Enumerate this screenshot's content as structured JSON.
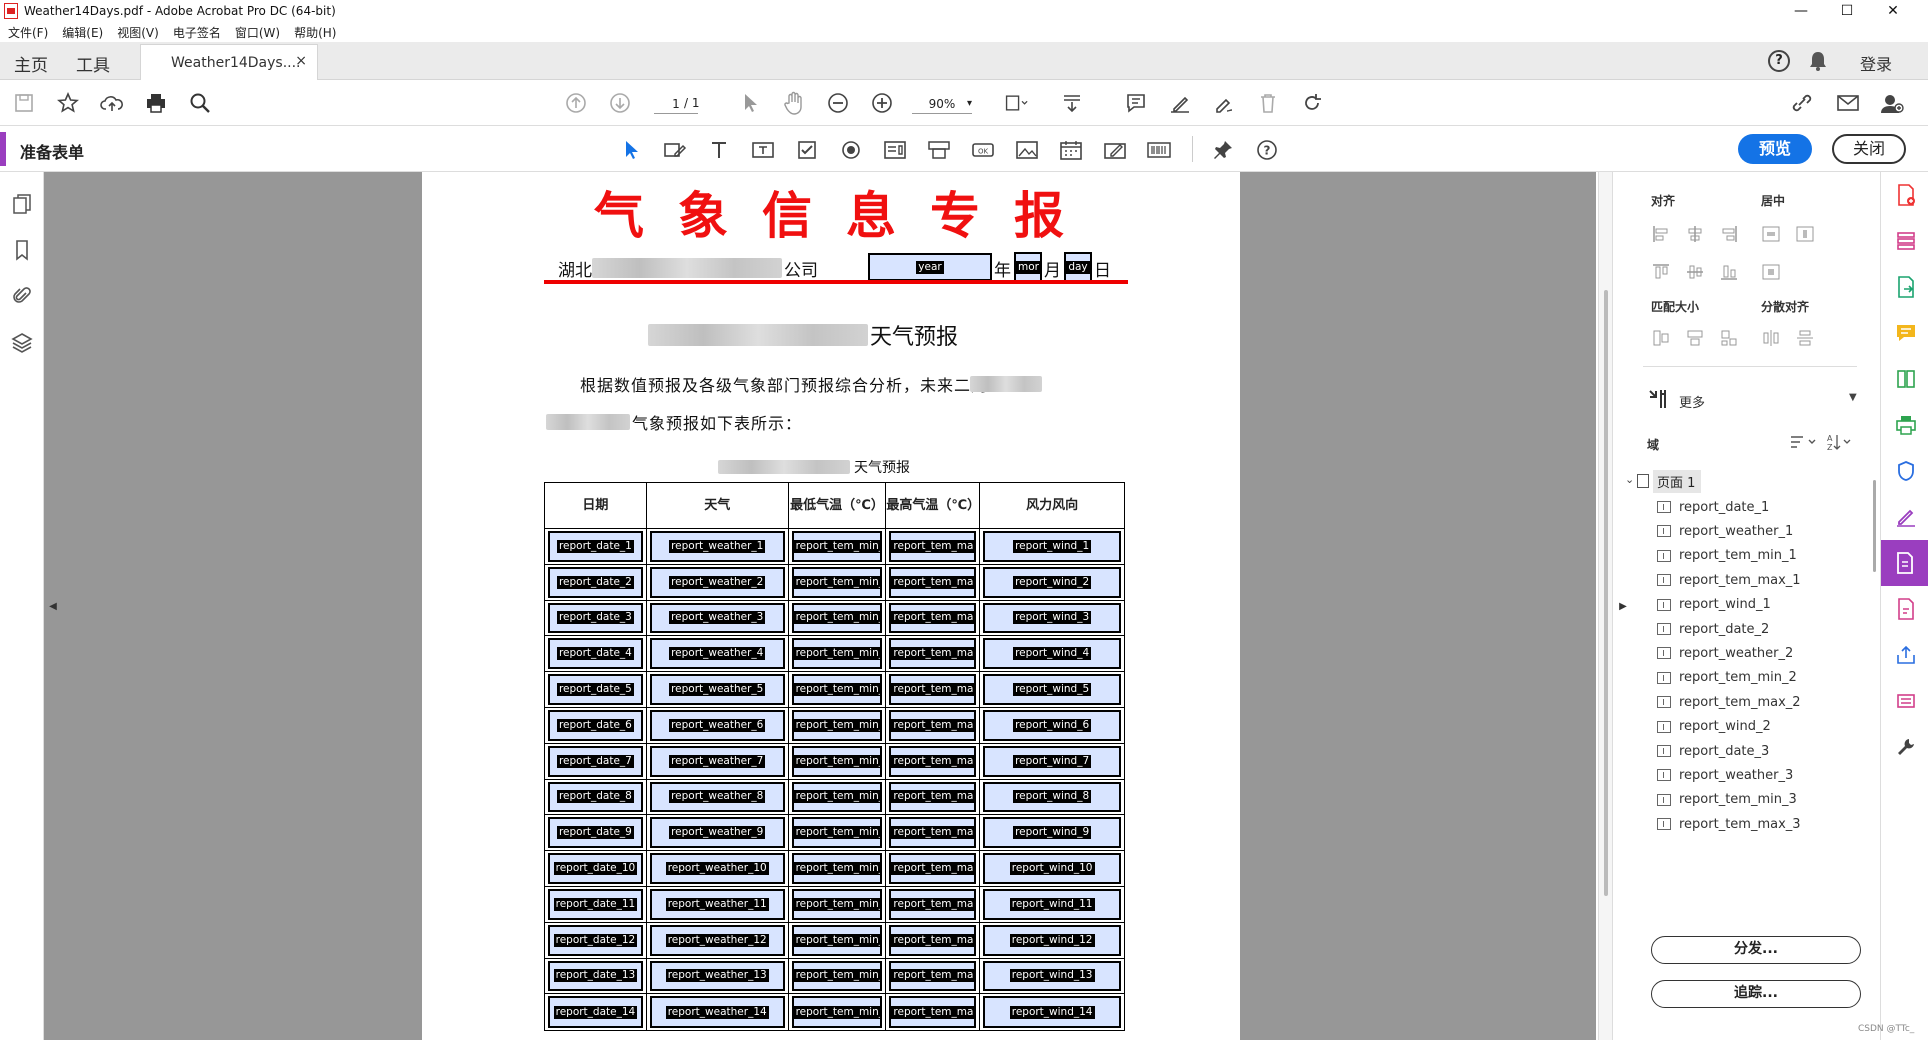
{
  "window": {
    "title": "Weather14Days.pdf - Adobe Acrobat Pro DC (64-bit)",
    "controls": [
      "—",
      "☐",
      "✕"
    ]
  },
  "menu": [
    "文件(F)",
    "编辑(E)",
    "视图(V)",
    "电子签名",
    "窗口(W)",
    "帮助(H)"
  ],
  "tabs": {
    "home": "主页",
    "tools": "工具",
    "doc": "Weather14Days....",
    "close": "×",
    "login": "登录"
  },
  "toolbar": {
    "page_current": "1",
    "page_total": "/ 1",
    "zoom": "90%"
  },
  "formbar": {
    "label": "准备表单",
    "preview": "预览",
    "close": "关闭"
  },
  "document": {
    "banner": "气象信息专报",
    "company_prefix": "湖北",
    "company_suffix": "公司",
    "year_field": "year",
    "year_label": "年",
    "month_field": "mor",
    "month_label": "月",
    "day_field": "day",
    "day_label": "日",
    "heading": "天气预报",
    "para1": "根据数值预报及各级气象部门预报综合分析，未来二周",
    "para2": "气象预报如下表所示：",
    "table_caption": "天气预报",
    "columns": [
      "日期",
      "天气",
      "最低气温（℃）",
      "最高气温（℃）",
      "风力风向"
    ],
    "rows": [
      [
        "report_date_1",
        "report_weather_1",
        "report_tem_min_",
        "report_tem_ma",
        "report_wind_1"
      ],
      [
        "report_date_2",
        "report_weather_2",
        "report_tem_min_",
        "report_tem_ma",
        "report_wind_2"
      ],
      [
        "report_date_3",
        "report_weather_3",
        "report_tem_min_",
        "report_tem_ma",
        "report_wind_3"
      ],
      [
        "report_date_4",
        "report_weather_4",
        "report_tem_min_",
        "report_tem_ma",
        "report_wind_4"
      ],
      [
        "report_date_5",
        "report_weather_5",
        "report_tem_min_",
        "report_tem_ma",
        "report_wind_5"
      ],
      [
        "report_date_6",
        "report_weather_6",
        "report_tem_min_",
        "report_tem_ma",
        "report_wind_6"
      ],
      [
        "report_date_7",
        "report_weather_7",
        "report_tem_min_",
        "report_tem_ma",
        "report_wind_7"
      ],
      [
        "report_date_8",
        "report_weather_8",
        "report_tem_min_",
        "report_tem_ma",
        "report_wind_8"
      ],
      [
        "report_date_9",
        "report_weather_9",
        "report_tem_min_",
        "report_tem_ma",
        "report_wind_9"
      ],
      [
        "report_date_10",
        "report_weather_10",
        "report_tem_min_",
        "report_tem_ma",
        "report_wind_10"
      ],
      [
        "report_date_11",
        "report_weather_11",
        "report_tem_min_",
        "report_tem_ma",
        "report_wind_11"
      ],
      [
        "report_date_12",
        "report_weather_12",
        "report_tem_min_",
        "report_tem_ma",
        "report_wind_12"
      ],
      [
        "report_date_13",
        "report_weather_13",
        "report_tem_min_",
        "report_tem_ma",
        "report_wind_13"
      ],
      [
        "report_date_14",
        "report_weather_14",
        "report_tem_min_",
        "report_tem_ma",
        "report_wind_14"
      ]
    ]
  },
  "right_panel": {
    "align": "对齐",
    "center": "居中",
    "match_size": "匹配大小",
    "distribute": "分散对齐",
    "more": "更多",
    "fields_label": "域",
    "page_node": "页面 1",
    "fields": [
      "report_date_1",
      "report_weather_1",
      "report_tem_min_1",
      "report_tem_max_1",
      "report_wind_1",
      "report_date_2",
      "report_weather_2",
      "report_tem_min_2",
      "report_tem_max_2",
      "report_wind_2",
      "report_date_3",
      "report_weather_3",
      "report_tem_min_3",
      "report_tem_max_3"
    ],
    "distribute_btn": "分发...",
    "track_btn": "追踪..."
  },
  "watermark": "CSDN @TTc_",
  "colors": {
    "accent_purple": "#9a3ebf",
    "primary_blue": "#1473e6",
    "banner_red": "#f01010",
    "field_fill": "#d8e4ff"
  }
}
